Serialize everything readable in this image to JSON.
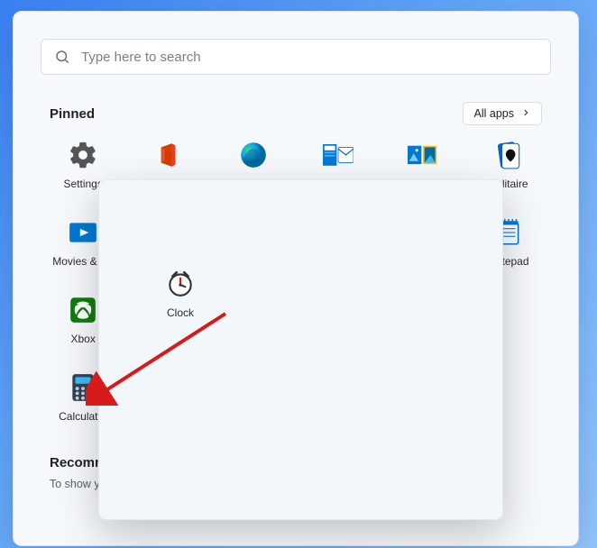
{
  "search": {
    "placeholder": "Type here to search"
  },
  "pinned": {
    "header": "Pinned",
    "all_apps_label": "All apps",
    "apps": [
      {
        "label": "Settings"
      },
      {
        "label": "Office"
      },
      {
        "label": "Edge"
      },
      {
        "label": "Mail"
      },
      {
        "label": "Photos"
      },
      {
        "label": "Solitaire"
      },
      {
        "label": "Movies & TV"
      },
      {
        "label": ""
      },
      {
        "label": ""
      },
      {
        "label": ""
      },
      {
        "label": ""
      },
      {
        "label": "Notepad"
      },
      {
        "label": "Xbox"
      },
      {
        "label": ""
      },
      {
        "label": ""
      },
      {
        "label": ""
      },
      {
        "label": ""
      },
      {
        "label": ""
      },
      {
        "label": "Calculator"
      }
    ]
  },
  "recommended": {
    "header": "Recommended",
    "subtext": "To show your recent files and new apps, turn them on in Settings."
  },
  "popup": {
    "group_app": {
      "label": "Clock"
    }
  },
  "colors": {
    "accent": "#0078d4",
    "arrow": "#d71a1a"
  }
}
